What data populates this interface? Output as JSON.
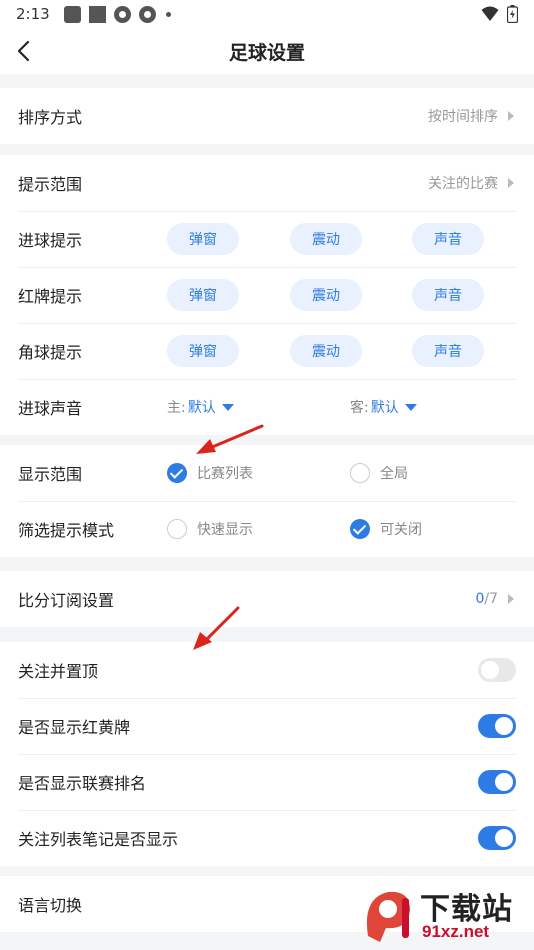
{
  "status": {
    "time": "2:13"
  },
  "nav": {
    "title": "足球设置"
  },
  "sort": {
    "label": "排序方式",
    "value": "按时间排序"
  },
  "alerts": {
    "range": {
      "label": "提示范围",
      "value": "关注的比赛"
    },
    "goal": {
      "label": "进球提示",
      "chips": [
        "弹窗",
        "震动",
        "声音"
      ]
    },
    "red": {
      "label": "红牌提示",
      "chips": [
        "弹窗",
        "震动",
        "声音"
      ]
    },
    "corner": {
      "label": "角球提示",
      "chips": [
        "弹窗",
        "震动",
        "声音"
      ]
    },
    "sound": {
      "label": "进球声音",
      "home_prefix": "主:",
      "home_value": "默认",
      "away_prefix": "客:",
      "away_value": "默认"
    }
  },
  "display": {
    "scope": {
      "label": "显示范围",
      "option1": "比赛列表",
      "option2": "全局"
    },
    "filter": {
      "label": "筛选提示模式",
      "option1": "快速显示",
      "option2": "可关闭"
    }
  },
  "subscription": {
    "label": "比分订阅设置",
    "count": "0",
    "total": "/7"
  },
  "toggles": {
    "pin": {
      "label": "关注并置顶",
      "on": false
    },
    "cards": {
      "label": "是否显示红黄牌",
      "on": true
    },
    "rank": {
      "label": "是否显示联赛排名",
      "on": true
    },
    "notes": {
      "label": "关注列表笔记是否显示",
      "on": true
    }
  },
  "language": {
    "label": "语言切换"
  },
  "watermark": {
    "title": "下载站",
    "site": "91xz.net"
  },
  "colors": {
    "accent": "#2d7be5",
    "chip_bg": "#e8f1fd",
    "annotation": "#d9261c"
  }
}
